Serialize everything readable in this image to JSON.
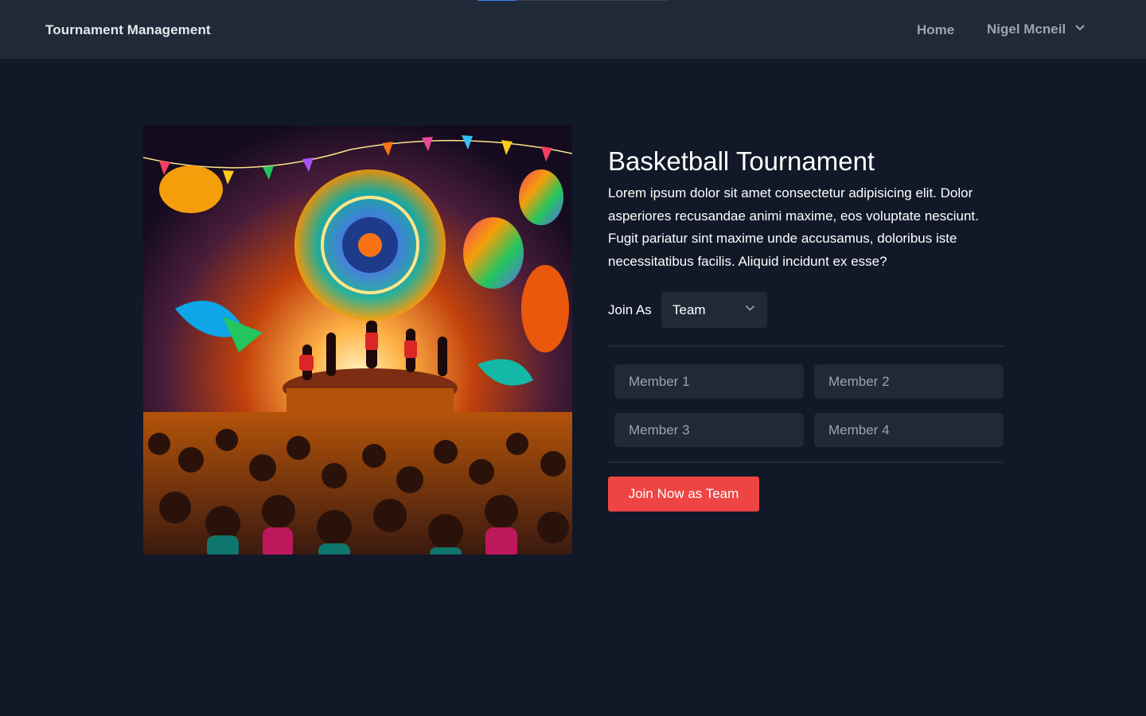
{
  "navbar": {
    "brand": "Tournament Management",
    "home_label": "Home",
    "user_name": "Nigel Mcneil",
    "loading_progress": 0.2
  },
  "tournament": {
    "title": "Basketball Tournament",
    "description": "Lorem ipsum dolor sit amet consectetur adipisicing elit. Dolor asperiores recusandae animi maxime, eos voluptate nesciunt. Fugit pariatur sint maxime unde accusamus, doloribus iste necessitatibus facilis. Aliquid incidunt ex esse?",
    "image_icon": "festival-illustration"
  },
  "join_form": {
    "join_as_label": "Join As",
    "join_as_selected": "Team",
    "members": [
      {
        "placeholder": "Member 1"
      },
      {
        "placeholder": "Member 2"
      },
      {
        "placeholder": "Member 3"
      },
      {
        "placeholder": "Member 4"
      }
    ],
    "submit_label": "Join Now as Team"
  },
  "colors": {
    "background": "#111827",
    "navbar": "#1f2937",
    "accent": "#ef4444",
    "progress": "#3b82f6"
  }
}
